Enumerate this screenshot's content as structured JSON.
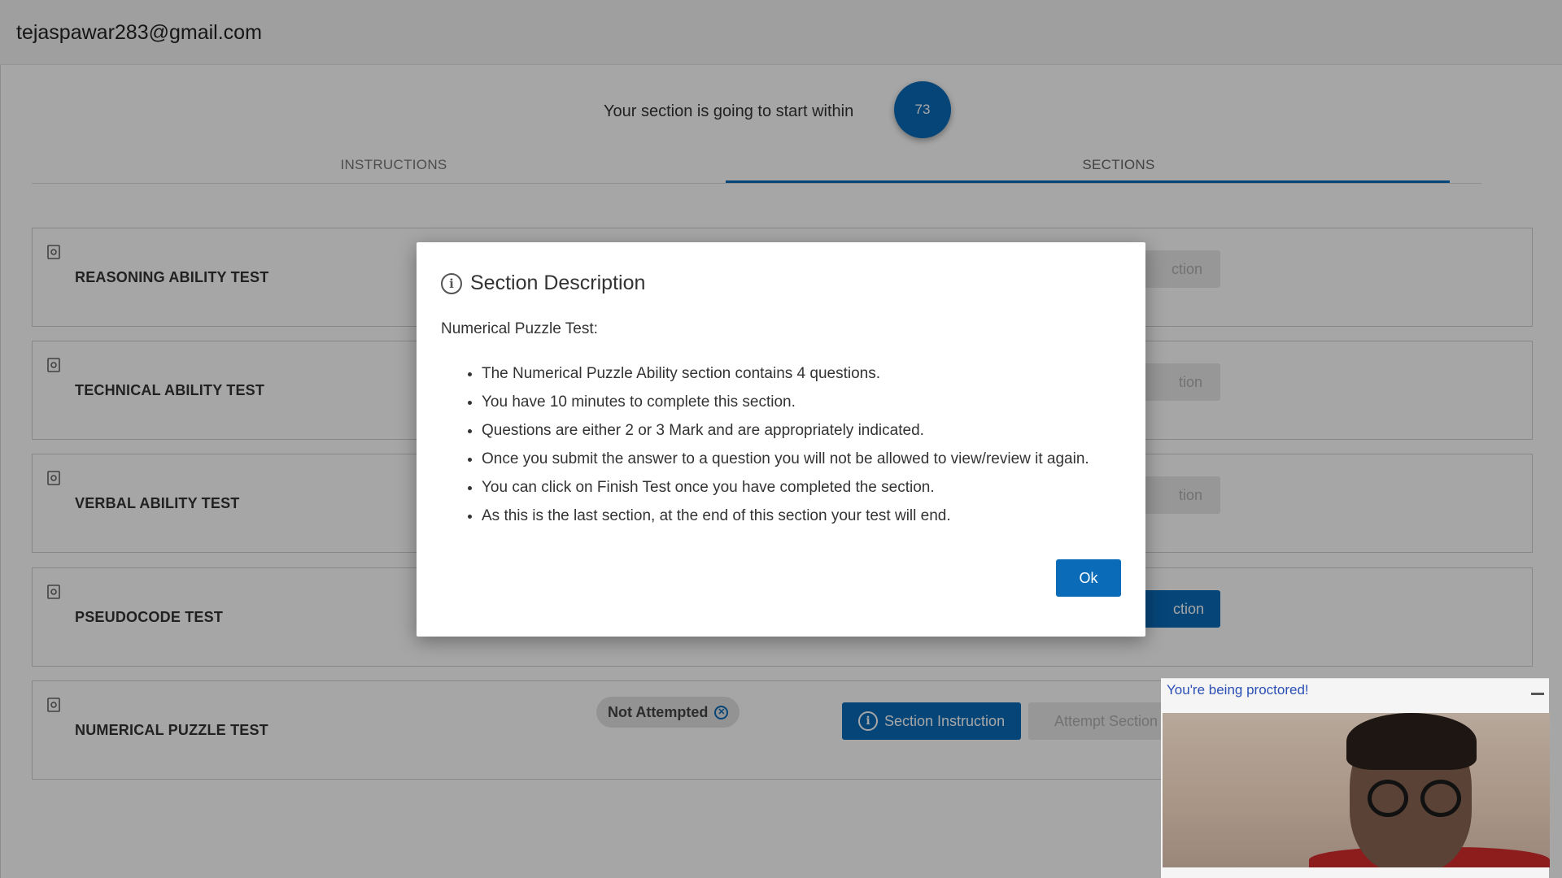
{
  "topbar": {
    "email": "tejaspawar283@gmail.com"
  },
  "timer": {
    "label": "Your section is going to start within",
    "value": "73"
  },
  "tabs": [
    {
      "label": "INSTRUCTIONS",
      "active": false
    },
    {
      "label": "SECTIONS",
      "active": true
    }
  ],
  "sections": [
    {
      "title": "REASONING ABILITY TEST"
    },
    {
      "title": "TECHNICAL ABILITY TEST"
    },
    {
      "title": "VERBAL ABILITY TEST"
    },
    {
      "title": "PSEUDOCODE TEST"
    },
    {
      "title": "NUMERICAL PUZZLE TEST",
      "status": "Not Attempted",
      "instruction_label": "Section Instruction",
      "attempt_label": "Attempt Section"
    }
  ],
  "hidden_buttons": {
    "partial_label": "ction",
    "partial_label_alt": "tion"
  },
  "modal": {
    "title": "Section Description",
    "subtitle": "Numerical Puzzle Test:",
    "items": [
      "The Numerical Puzzle Ability section contains 4 questions.",
      "You have 10 minutes to complete this section.",
      "Questions are either 2 or 3 Mark and are appropriately indicated.",
      "Once you submit the answer to a question you will not be allowed to view/review it again.",
      "You can click on Finish Test once you have completed the section.",
      "As this is the last section, at the end of this section your test will end."
    ],
    "ok_label": "Ok"
  },
  "proctor": {
    "title": "You're being proctored!"
  },
  "colors": {
    "primary": "#0a6bb8",
    "badge_bg": "#e2e2e2",
    "proctor_text": "#2a4fb5"
  }
}
